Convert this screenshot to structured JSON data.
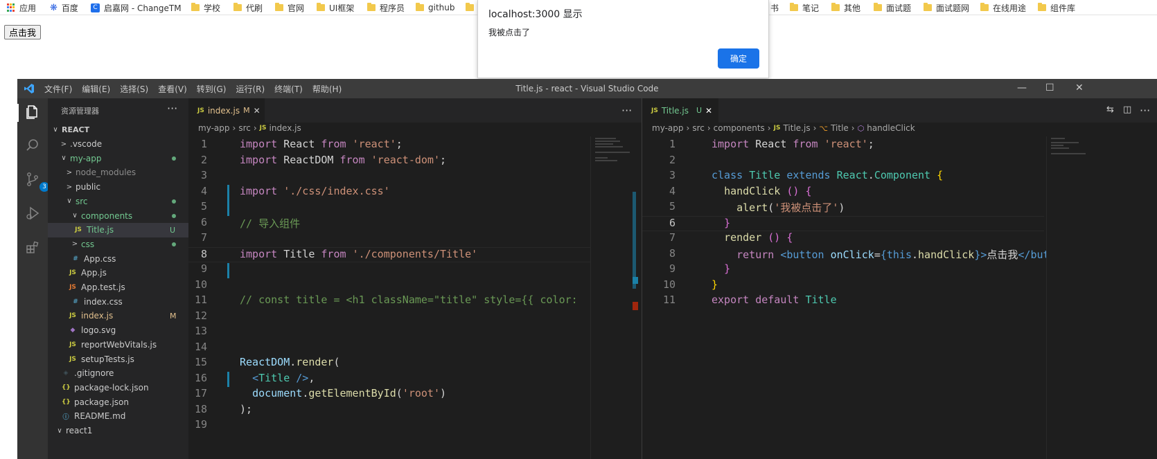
{
  "bookmarks": {
    "items": [
      {
        "label": "应用",
        "icon": "apps-icon"
      },
      {
        "label": "百度",
        "icon": "paw-icon"
      },
      {
        "label": "启嘉网 - ChangeTM",
        "icon": "c-icon"
      },
      {
        "label": "学校",
        "icon": "folder-icon"
      },
      {
        "label": "代刷",
        "icon": "folder-icon"
      },
      {
        "label": "官网",
        "icon": "folder-icon"
      },
      {
        "label": "UI框架",
        "icon": "folder-icon"
      },
      {
        "label": "程序员",
        "icon": "folder-icon"
      },
      {
        "label": "github",
        "icon": "folder-icon"
      },
      {
        "label": "书",
        "icon": "folder-icon"
      },
      {
        "label": "笔记",
        "icon": "folder-icon"
      },
      {
        "label": "其他",
        "icon": "folder-icon"
      },
      {
        "label": "面试题",
        "icon": "folder-icon"
      },
      {
        "label": "面试题网",
        "icon": "folder-icon"
      },
      {
        "label": "在线用途",
        "icon": "folder-icon"
      },
      {
        "label": "组件库",
        "icon": "folder-icon"
      }
    ]
  },
  "page": {
    "button_label": "点击我"
  },
  "alert": {
    "title": "localhost:3000 显示",
    "message": "我被点击了",
    "ok_label": "确定"
  },
  "vscode": {
    "menu": [
      "文件(F)",
      "编辑(E)",
      "选择(S)",
      "查看(V)",
      "转到(G)",
      "运行(R)",
      "终端(T)",
      "帮助(H)"
    ],
    "window_title": "Title.js - react - Visual Studio Code",
    "window_controls": {
      "minimize": "—",
      "maximize": "☐",
      "close": "✕"
    },
    "activity": {
      "scm_badge": "3"
    },
    "explorer": {
      "header": "资源管理器",
      "more": "···",
      "rows": [
        {
          "label": "REACT",
          "chev": "∨",
          "icon": "",
          "color": "#cccccc",
          "indent": 6,
          "bold": true
        },
        {
          "label": ".vscode",
          "chev": ">",
          "icon": "",
          "color": "#cccccc",
          "indent": 18
        },
        {
          "label": "my-app",
          "chev": "∨",
          "icon": "",
          "color": "#73c991",
          "indent": 18,
          "dot": true
        },
        {
          "label": "node_modules",
          "chev": ">",
          "icon": "",
          "color": "#8c8c8c",
          "indent": 26
        },
        {
          "label": "public",
          "chev": ">",
          "icon": "",
          "color": "#cccccc",
          "indent": 26
        },
        {
          "label": "src",
          "chev": "∨",
          "icon": "",
          "color": "#73c991",
          "indent": 26,
          "dot": true
        },
        {
          "label": "components",
          "chev": "∨",
          "icon": "",
          "color": "#73c991",
          "indent": 34,
          "dot": true
        },
        {
          "label": "Title.js",
          "chev": "",
          "icon": "JS",
          "iconColor": "#cbcb41",
          "color": "#73c991",
          "indent": 38,
          "badge": "U",
          "selected": true
        },
        {
          "label": "css",
          "chev": ">",
          "icon": "",
          "color": "#73c991",
          "indent": 34,
          "dot": true
        },
        {
          "label": "App.css",
          "chev": "",
          "icon": "#",
          "iconColor": "#519aba",
          "color": "#cccccc",
          "indent": 34
        },
        {
          "label": "App.js",
          "chev": "",
          "icon": "JS",
          "iconColor": "#cbcb41",
          "color": "#cccccc",
          "indent": 30
        },
        {
          "label": "App.test.js",
          "chev": "",
          "icon": "JS",
          "iconColor": "#e37933",
          "color": "#cccccc",
          "indent": 30
        },
        {
          "label": "index.css",
          "chev": "",
          "icon": "#",
          "iconColor": "#519aba",
          "color": "#cccccc",
          "indent": 34
        },
        {
          "label": "index.js",
          "chev": "",
          "icon": "JS",
          "iconColor": "#cbcb41",
          "color": "#e2c08d",
          "indent": 30,
          "badge": "M"
        },
        {
          "label": "logo.svg",
          "chev": "",
          "icon": "◆",
          "iconColor": "#a074c4",
          "color": "#cccccc",
          "indent": 30
        },
        {
          "label": "reportWebVitals.js",
          "chev": "",
          "icon": "JS",
          "iconColor": "#cbcb41",
          "color": "#cccccc",
          "indent": 30
        },
        {
          "label": "setupTests.js",
          "chev": "",
          "icon": "JS",
          "iconColor": "#cbcb41",
          "color": "#cccccc",
          "indent": 30
        },
        {
          "label": ".gitignore",
          "chev": "",
          "icon": "◈",
          "iconColor": "#41535b",
          "color": "#cccccc",
          "indent": 20
        },
        {
          "label": "package-lock.json",
          "chev": "",
          "icon": "{}",
          "iconColor": "#cbcb41",
          "color": "#cccccc",
          "indent": 20
        },
        {
          "label": "package.json",
          "chev": "",
          "icon": "{}",
          "iconColor": "#cbcb41",
          "color": "#cccccc",
          "indent": 20
        },
        {
          "label": "README.md",
          "chev": "",
          "icon": "ⓘ",
          "iconColor": "#519aba",
          "color": "#cccccc",
          "indent": 20
        },
        {
          "label": "react1",
          "chev": "∨",
          "icon": "",
          "color": "#cccccc",
          "indent": 12
        }
      ]
    },
    "left_editor": {
      "tab": {
        "lang": "JS",
        "name": "index.js",
        "status": "M",
        "close": "✕"
      },
      "more": "···",
      "breadcrumb": [
        "my-app",
        "src",
        "index.js"
      ],
      "current_line": 8,
      "lines": [
        {
          "n": "1",
          "tokens": [
            [
              "kw2",
              "import"
            ],
            [
              "plain",
              " React "
            ],
            [
              "kw2",
              "from"
            ],
            [
              "plain",
              " "
            ],
            [
              "str",
              "'react'"
            ],
            [
              "plain",
              ";"
            ]
          ]
        },
        {
          "n": "2",
          "tokens": [
            [
              "kw2",
              "import"
            ],
            [
              "plain",
              " ReactDOM "
            ],
            [
              "kw2",
              "from"
            ],
            [
              "plain",
              " "
            ],
            [
              "str",
              "'react-dom'"
            ],
            [
              "plain",
              ";"
            ]
          ]
        },
        {
          "n": "3",
          "tokens": []
        },
        {
          "n": "4",
          "tokens": [
            [
              "kw2",
              "import"
            ],
            [
              "plain",
              " "
            ],
            [
              "str",
              "'./css/index.css'"
            ]
          ]
        },
        {
          "n": "5",
          "tokens": []
        },
        {
          "n": "6",
          "tokens": [
            [
              "cmt",
              "// 导入组件"
            ]
          ]
        },
        {
          "n": "7",
          "tokens": []
        },
        {
          "n": "8",
          "tokens": [
            [
              "kw2",
              "import"
            ],
            [
              "plain",
              " Title "
            ],
            [
              "kw2",
              "from"
            ],
            [
              "plain",
              " "
            ],
            [
              "str",
              "'./components/Title'"
            ]
          ]
        },
        {
          "n": "9",
          "tokens": []
        },
        {
          "n": "10",
          "tokens": []
        },
        {
          "n": "11",
          "tokens": [
            [
              "cmt",
              "// const title = <h1 className=\"title\" style={{ color:"
            ]
          ]
        },
        {
          "n": "12",
          "tokens": []
        },
        {
          "n": "13",
          "tokens": []
        },
        {
          "n": "14",
          "tokens": []
        },
        {
          "n": "15",
          "tokens": [
            [
              "var",
              "ReactDOM"
            ],
            [
              "plain",
              "."
            ],
            [
              "fn",
              "render"
            ],
            [
              "plain",
              "("
            ]
          ]
        },
        {
          "n": "16",
          "tokens": [
            [
              "plain",
              "  "
            ],
            [
              "tag",
              "<"
            ],
            [
              "cls",
              "Title"
            ],
            [
              "plain",
              " "
            ],
            [
              "tag",
              "/>"
            ],
            [
              "plain",
              ","
            ]
          ]
        },
        {
          "n": "17",
          "tokens": [
            [
              "plain",
              "  "
            ],
            [
              "var",
              "document"
            ],
            [
              "plain",
              "."
            ],
            [
              "fn",
              "getElementById"
            ],
            [
              "plain",
              "("
            ],
            [
              "str",
              "'root'"
            ],
            [
              "plain",
              ")"
            ]
          ]
        },
        {
          "n": "18",
          "tokens": [
            [
              "plain",
              ");"
            ]
          ]
        },
        {
          "n": "19",
          "tokens": []
        }
      ]
    },
    "right_editor": {
      "tab": {
        "lang": "JS",
        "name": "Title.js",
        "status": "U",
        "close": "✕"
      },
      "actions": [
        "⇆",
        "◫",
        "···"
      ],
      "breadcrumb": [
        "my-app",
        "src",
        "components",
        "Title.js",
        "Title",
        "handleClick"
      ],
      "current_line": 6,
      "lines": [
        {
          "n": "1",
          "tokens": [
            [
              "kw2",
              "import"
            ],
            [
              "plain",
              " React "
            ],
            [
              "kw2",
              "from"
            ],
            [
              "plain",
              " "
            ],
            [
              "str",
              "'react'"
            ],
            [
              "plain",
              ";"
            ]
          ]
        },
        {
          "n": "2",
          "tokens": []
        },
        {
          "n": "3",
          "tokens": [
            [
              "kw",
              "class"
            ],
            [
              "plain",
              " "
            ],
            [
              "cls",
              "Title"
            ],
            [
              "plain",
              " "
            ],
            [
              "kw",
              "extends"
            ],
            [
              "plain",
              " "
            ],
            [
              "cls",
              "React"
            ],
            [
              "plain",
              "."
            ],
            [
              "cls",
              "Component"
            ],
            [
              "plain",
              " "
            ],
            [
              "brace",
              "{"
            ]
          ]
        },
        {
          "n": "4",
          "tokens": [
            [
              "plain",
              "  "
            ],
            [
              "fn",
              "handClick"
            ],
            [
              "plain",
              " "
            ],
            [
              "paren",
              "()"
            ],
            [
              "plain",
              " "
            ],
            [
              "paren",
              "{"
            ]
          ]
        },
        {
          "n": "5",
          "tokens": [
            [
              "plain",
              "    "
            ],
            [
              "fn",
              "alert"
            ],
            [
              "plain",
              "("
            ],
            [
              "str",
              "'我被点击了'"
            ],
            [
              "plain",
              ")"
            ]
          ]
        },
        {
          "n": "6",
          "tokens": [
            [
              "plain",
              "  "
            ],
            [
              "paren",
              "}"
            ]
          ]
        },
        {
          "n": "7",
          "tokens": [
            [
              "plain",
              "  "
            ],
            [
              "fn",
              "render"
            ],
            [
              "plain",
              " "
            ],
            [
              "paren",
              "()"
            ],
            [
              "plain",
              " "
            ],
            [
              "paren",
              "{"
            ]
          ]
        },
        {
          "n": "8",
          "tokens": [
            [
              "plain",
              "    "
            ],
            [
              "kw2",
              "return"
            ],
            [
              "plain",
              " "
            ],
            [
              "tag",
              "<"
            ],
            [
              "tag",
              "button"
            ],
            [
              "plain",
              " "
            ],
            [
              "attr",
              "onClick"
            ],
            [
              "plain",
              "="
            ],
            [
              "tag",
              "{"
            ],
            [
              "kw",
              "this"
            ],
            [
              "plain",
              "."
            ],
            [
              "fn",
              "handClick"
            ],
            [
              "tag",
              "}"
            ],
            [
              "tag",
              ">"
            ],
            [
              "plain",
              "点击我"
            ],
            [
              "tag",
              "</but"
            ]
          ]
        },
        {
          "n": "9",
          "tokens": [
            [
              "plain",
              "  "
            ],
            [
              "paren",
              "}"
            ]
          ]
        },
        {
          "n": "10",
          "tokens": [
            [
              "brace",
              "}"
            ]
          ]
        },
        {
          "n": "11",
          "tokens": [
            [
              "kw2",
              "export"
            ],
            [
              "plain",
              " "
            ],
            [
              "kw2",
              "default"
            ],
            [
              "plain",
              " "
            ],
            [
              "cls",
              "Title"
            ]
          ]
        }
      ]
    }
  }
}
